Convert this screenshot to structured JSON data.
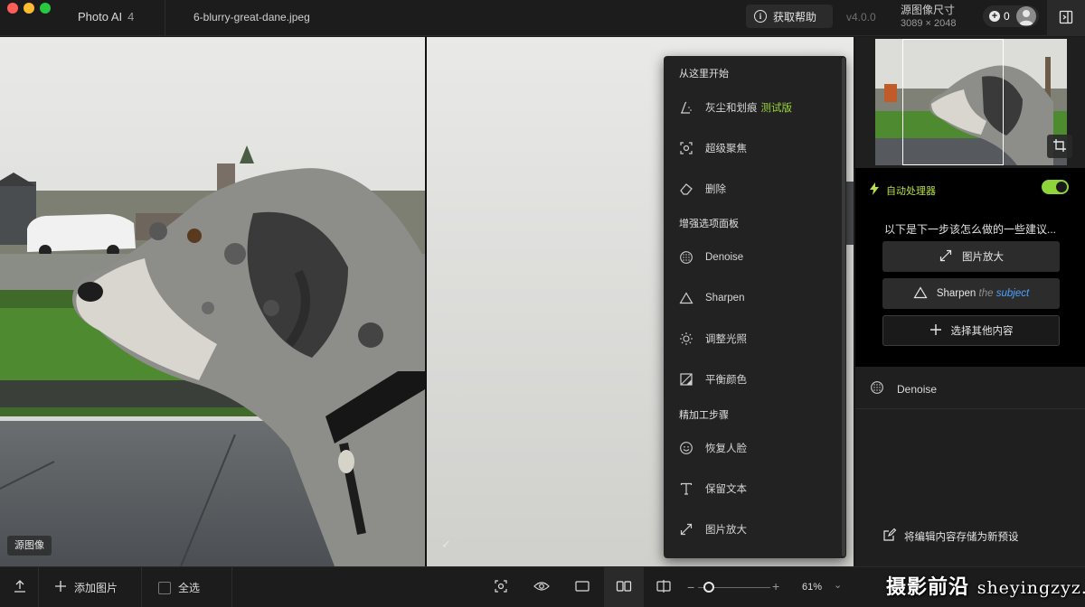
{
  "titlebar": {
    "app_name": "Photo AI",
    "app_version_badge": "4",
    "file_name": "6-blurry-great-dane.jpeg",
    "help_label": "获取帮助",
    "version": "v4.0.0",
    "source_size_label": "源图像尺寸",
    "source_size_value": "3089 × 2048",
    "credits": "0"
  },
  "viewport": {
    "source_tag": "源图像",
    "preview_check": "✓"
  },
  "menu": {
    "sections": [
      {
        "title": "从这里开始",
        "items": [
          {
            "label": "灰尘和划痕",
            "badge": "测试版",
            "icon": "dust-brush-icon"
          },
          {
            "label": "超级聚焦",
            "icon": "focus-icon"
          },
          {
            "label": "删除",
            "icon": "eraser-icon"
          }
        ]
      },
      {
        "title": "增强选项面板",
        "items": [
          {
            "label": "Denoise",
            "icon": "denoise-icon"
          },
          {
            "label": "Sharpen",
            "icon": "triangle-icon"
          },
          {
            "label": "调整光照",
            "icon": "light-icon"
          },
          {
            "label": "平衡颜色",
            "icon": "color-balance-icon"
          }
        ]
      },
      {
        "title": "精加工步骤",
        "items": [
          {
            "label": "恢复人脸",
            "icon": "face-icon"
          },
          {
            "label": "保留文本",
            "icon": "text-icon"
          },
          {
            "label": "图片放大",
            "icon": "upscale-icon"
          }
        ]
      }
    ]
  },
  "panel": {
    "auto_label": "自动处理器",
    "auto_enabled": true,
    "suggest_text": "以下是下一步该怎么做的一些建议...",
    "upscale_label": "图片放大",
    "sharpen_word": "Sharpen",
    "sharpen_the": "the",
    "sharpen_subject": "subject",
    "other_label": "选择其他内容",
    "denoise_label": "Denoise",
    "save_preset_label": "将编辑内容存储为新预设"
  },
  "bottombar": {
    "add_image_label": "添加图片",
    "select_all_label": "全选",
    "zoom": "61%",
    "zoom_slider_fraction": 0.1
  },
  "watermark": {
    "text": "摄影前沿",
    "url": "sheyingzyz.com"
  },
  "colors": {
    "accent_green": "#9ad43a",
    "link_blue": "#4da3ff",
    "traffic_red": "#ff5f57",
    "traffic_yellow": "#febc2e",
    "traffic_green": "#28c840"
  }
}
